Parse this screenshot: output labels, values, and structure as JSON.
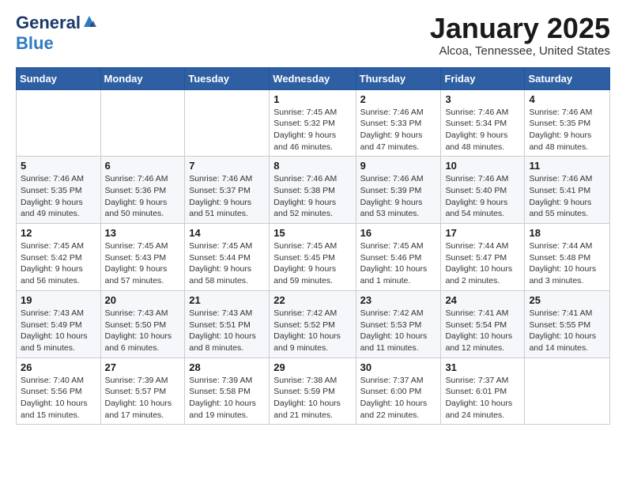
{
  "logo": {
    "general": "General",
    "blue": "Blue"
  },
  "title": "January 2025",
  "subtitle": "Alcoa, Tennessee, United States",
  "weekdays": [
    "Sunday",
    "Monday",
    "Tuesday",
    "Wednesday",
    "Thursday",
    "Friday",
    "Saturday"
  ],
  "weeks": [
    [
      {
        "day": "",
        "info": ""
      },
      {
        "day": "",
        "info": ""
      },
      {
        "day": "",
        "info": ""
      },
      {
        "day": "1",
        "info": "Sunrise: 7:45 AM\nSunset: 5:32 PM\nDaylight: 9 hours\nand 46 minutes."
      },
      {
        "day": "2",
        "info": "Sunrise: 7:46 AM\nSunset: 5:33 PM\nDaylight: 9 hours\nand 47 minutes."
      },
      {
        "day": "3",
        "info": "Sunrise: 7:46 AM\nSunset: 5:34 PM\nDaylight: 9 hours\nand 48 minutes."
      },
      {
        "day": "4",
        "info": "Sunrise: 7:46 AM\nSunset: 5:35 PM\nDaylight: 9 hours\nand 48 minutes."
      }
    ],
    [
      {
        "day": "5",
        "info": "Sunrise: 7:46 AM\nSunset: 5:35 PM\nDaylight: 9 hours\nand 49 minutes."
      },
      {
        "day": "6",
        "info": "Sunrise: 7:46 AM\nSunset: 5:36 PM\nDaylight: 9 hours\nand 50 minutes."
      },
      {
        "day": "7",
        "info": "Sunrise: 7:46 AM\nSunset: 5:37 PM\nDaylight: 9 hours\nand 51 minutes."
      },
      {
        "day": "8",
        "info": "Sunrise: 7:46 AM\nSunset: 5:38 PM\nDaylight: 9 hours\nand 52 minutes."
      },
      {
        "day": "9",
        "info": "Sunrise: 7:46 AM\nSunset: 5:39 PM\nDaylight: 9 hours\nand 53 minutes."
      },
      {
        "day": "10",
        "info": "Sunrise: 7:46 AM\nSunset: 5:40 PM\nDaylight: 9 hours\nand 54 minutes."
      },
      {
        "day": "11",
        "info": "Sunrise: 7:46 AM\nSunset: 5:41 PM\nDaylight: 9 hours\nand 55 minutes."
      }
    ],
    [
      {
        "day": "12",
        "info": "Sunrise: 7:45 AM\nSunset: 5:42 PM\nDaylight: 9 hours\nand 56 minutes."
      },
      {
        "day": "13",
        "info": "Sunrise: 7:45 AM\nSunset: 5:43 PM\nDaylight: 9 hours\nand 57 minutes."
      },
      {
        "day": "14",
        "info": "Sunrise: 7:45 AM\nSunset: 5:44 PM\nDaylight: 9 hours\nand 58 minutes."
      },
      {
        "day": "15",
        "info": "Sunrise: 7:45 AM\nSunset: 5:45 PM\nDaylight: 9 hours\nand 59 minutes."
      },
      {
        "day": "16",
        "info": "Sunrise: 7:45 AM\nSunset: 5:46 PM\nDaylight: 10 hours\nand 1 minute."
      },
      {
        "day": "17",
        "info": "Sunrise: 7:44 AM\nSunset: 5:47 PM\nDaylight: 10 hours\nand 2 minutes."
      },
      {
        "day": "18",
        "info": "Sunrise: 7:44 AM\nSunset: 5:48 PM\nDaylight: 10 hours\nand 3 minutes."
      }
    ],
    [
      {
        "day": "19",
        "info": "Sunrise: 7:43 AM\nSunset: 5:49 PM\nDaylight: 10 hours\nand 5 minutes."
      },
      {
        "day": "20",
        "info": "Sunrise: 7:43 AM\nSunset: 5:50 PM\nDaylight: 10 hours\nand 6 minutes."
      },
      {
        "day": "21",
        "info": "Sunrise: 7:43 AM\nSunset: 5:51 PM\nDaylight: 10 hours\nand 8 minutes."
      },
      {
        "day": "22",
        "info": "Sunrise: 7:42 AM\nSunset: 5:52 PM\nDaylight: 10 hours\nand 9 minutes."
      },
      {
        "day": "23",
        "info": "Sunrise: 7:42 AM\nSunset: 5:53 PM\nDaylight: 10 hours\nand 11 minutes."
      },
      {
        "day": "24",
        "info": "Sunrise: 7:41 AM\nSunset: 5:54 PM\nDaylight: 10 hours\nand 12 minutes."
      },
      {
        "day": "25",
        "info": "Sunrise: 7:41 AM\nSunset: 5:55 PM\nDaylight: 10 hours\nand 14 minutes."
      }
    ],
    [
      {
        "day": "26",
        "info": "Sunrise: 7:40 AM\nSunset: 5:56 PM\nDaylight: 10 hours\nand 15 minutes."
      },
      {
        "day": "27",
        "info": "Sunrise: 7:39 AM\nSunset: 5:57 PM\nDaylight: 10 hours\nand 17 minutes."
      },
      {
        "day": "28",
        "info": "Sunrise: 7:39 AM\nSunset: 5:58 PM\nDaylight: 10 hours\nand 19 minutes."
      },
      {
        "day": "29",
        "info": "Sunrise: 7:38 AM\nSunset: 5:59 PM\nDaylight: 10 hours\nand 21 minutes."
      },
      {
        "day": "30",
        "info": "Sunrise: 7:37 AM\nSunset: 6:00 PM\nDaylight: 10 hours\nand 22 minutes."
      },
      {
        "day": "31",
        "info": "Sunrise: 7:37 AM\nSunset: 6:01 PM\nDaylight: 10 hours\nand 24 minutes."
      },
      {
        "day": "",
        "info": ""
      }
    ]
  ]
}
